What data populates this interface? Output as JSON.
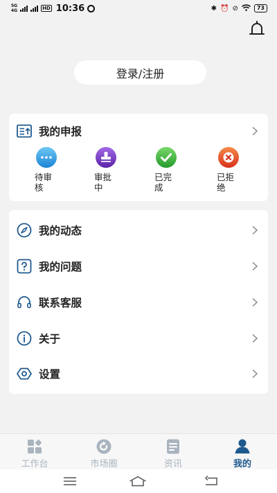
{
  "status_bar": {
    "network_top": "5G",
    "network_bottom": "4G",
    "hd": "HD",
    "time": "10:36",
    "battery": "73"
  },
  "header": {
    "login_label": "登录/注册"
  },
  "report": {
    "title": "我的申报",
    "statuses": [
      {
        "label": "待审核",
        "color": "#2f9fe0",
        "icon": "more-icon"
      },
      {
        "label": "审批中",
        "color": "#7a3cc8",
        "icon": "stamp-icon"
      },
      {
        "label": "已完成",
        "color": "#35b239",
        "icon": "check-icon"
      },
      {
        "label": "已拒绝",
        "color": "#e8512a",
        "icon": "cross-icon"
      }
    ]
  },
  "menu": {
    "items": [
      {
        "label": "我的动态",
        "icon": "compass-icon"
      },
      {
        "label": "我的问题",
        "icon": "question-icon"
      },
      {
        "label": "联系客服",
        "icon": "headset-icon"
      },
      {
        "label": "关于",
        "icon": "info-icon"
      },
      {
        "label": "设置",
        "icon": "settings-icon"
      }
    ]
  },
  "tabbar": {
    "tabs": [
      {
        "label": "工作台",
        "active": false
      },
      {
        "label": "市场圈",
        "active": false
      },
      {
        "label": "资讯",
        "active": false
      },
      {
        "label": "我的",
        "active": true
      }
    ],
    "active_color": "#1f5a8f",
    "inactive_color": "#aab4bf"
  },
  "theme": {
    "accent": "#1f5a8f",
    "background": "#f2f2f2"
  }
}
